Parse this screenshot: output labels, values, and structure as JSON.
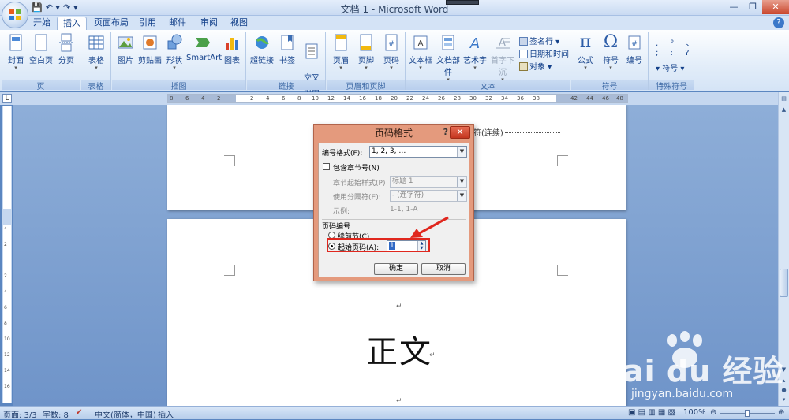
{
  "window": {
    "title": "文档 1 - Microsoft Word"
  },
  "qat": {
    "undo_icon": "undo-icon",
    "redo_icon": "redo-icon",
    "save_icon": "save-icon"
  },
  "tabs": [
    {
      "label": "开始"
    },
    {
      "label": "插入"
    },
    {
      "label": "页面布局"
    },
    {
      "label": "引用"
    },
    {
      "label": "邮件"
    },
    {
      "label": "审阅"
    },
    {
      "label": "视图"
    }
  ],
  "ribbon": {
    "groups": {
      "pages": "页",
      "tables": "表格",
      "illustrations": "插图",
      "links": "链接",
      "header_footer": "页眉和页脚",
      "text": "文本",
      "symbols": "符号",
      "special_symbols": "特殊符号"
    },
    "buttons": {
      "cover": "封面",
      "blank_page": "空白页",
      "page_break": "分页",
      "table": "表格",
      "picture": "图片",
      "clipart": "剪贴画",
      "shapes": "形状",
      "smartart": "SmartArt",
      "chart": "图表",
      "hyperlink": "超链接",
      "bookmark": "书签",
      "cross_ref": "交叉\n引用",
      "header": "页眉",
      "footer": "页脚",
      "page_number": "页码",
      "textbox": "文本框",
      "quick_parts": "文档部件",
      "wordart": "艺术字",
      "dropcap": "首字下沉",
      "signature": "签名行",
      "datetime": "日期和时间",
      "object": "对象",
      "equation": "公式",
      "symbol": "符号",
      "numbering": "编号",
      "special_symbol": "符号"
    }
  },
  "document": {
    "section_break": "符(连续)",
    "body_text": "正文",
    "para_mark": "↵"
  },
  "dialog": {
    "title": "页码格式",
    "help": "?",
    "close": "✕",
    "number_format_label": "编号格式(F):",
    "number_format_value": "1, 2, 3, …",
    "include_chapter_label": "包含章节号(N)",
    "chapter_style_label": "章节起始样式(P)",
    "chapter_style_value": "标题 1",
    "separator_label": "使用分隔符(E):",
    "separator_value": "-  (连字符)",
    "example_label": "示例:",
    "example_value": "1-1, 1-A",
    "page_numbering_label": "页码编号",
    "continue_label": "续前节(C)",
    "start_at_label": "起始页码(A):",
    "start_at_value": "1",
    "ok_label": "确定",
    "cancel_label": "取消"
  },
  "statusbar": {
    "page": "页面: 3/3",
    "words": "字数: 8",
    "language": "中文(简体，中国)",
    "mode": "插入",
    "zoom": "100%"
  },
  "watermark": {
    "brand": "Bai du 经验",
    "url": "jingyan.baidu.com"
  },
  "colors": {
    "accent": "#15428b",
    "dialog_frame": "#e49a7d",
    "highlight": "#e0271e"
  }
}
